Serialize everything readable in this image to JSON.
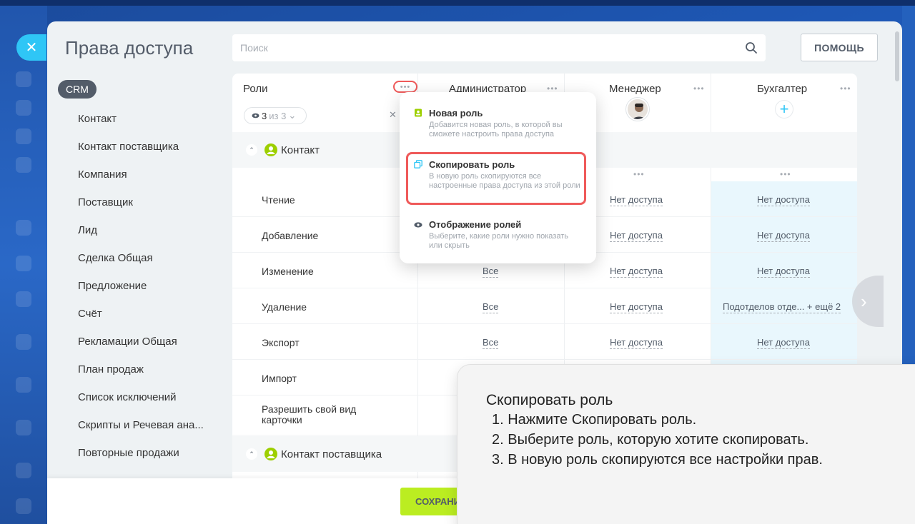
{
  "page": {
    "title": "Права доступа",
    "search_placeholder": "Поиск",
    "help_label": "ПОМОЩЬ",
    "close_symbol": "✕",
    "save_label": "СОХРАНИТЬ"
  },
  "sidebar": {
    "badge": "CRM",
    "items": [
      "Контакт",
      "Контакт поставщика",
      "Компания",
      "Поставщик",
      "Лид",
      "Сделка Общая",
      "Предложение",
      "Счёт",
      "Рекламации Общая",
      "План продаж",
      "Список исключений",
      "Скрипты и Речевая ана...",
      "Повторные продажи"
    ]
  },
  "table": {
    "roles_header": "Роли",
    "chip": {
      "count": "3",
      "of": "из 3"
    },
    "columns": [
      "Администратор",
      "Менеджер",
      "Бухгалтер"
    ],
    "section_contact": "Контакт",
    "section_supplier": "Контакт поставщика",
    "rows": [
      {
        "label": "Чтение",
        "admin": "",
        "manager": "Нет доступа",
        "accountant": "Нет доступа"
      },
      {
        "label": "Добавление",
        "admin": "",
        "manager": "Нет доступа",
        "accountant": "Нет доступа"
      },
      {
        "label": "Изменение",
        "admin": "Все",
        "manager": "Нет доступа",
        "accountant": "Нет доступа"
      },
      {
        "label": "Удаление",
        "admin": "Все",
        "manager": "Нет доступа",
        "accountant": "Подотделов отде... + ещё 2"
      },
      {
        "label": "Экспорт",
        "admin": "Все",
        "manager": "Нет доступа",
        "accountant": "Нет доступа"
      },
      {
        "label": "Импорт",
        "admin": "",
        "manager": "",
        "accountant": ""
      },
      {
        "label": "Разрешить свой вид карточки",
        "admin": "",
        "manager": "",
        "accountant": ""
      }
    ]
  },
  "menu": {
    "items": [
      {
        "title": "Новая роль",
        "desc": "Добавится новая роль, в которой вы сможете настроить права доступа"
      },
      {
        "title": "Скопировать роль",
        "desc": "В новую роль скопируются все настроенные права доступа из этой роли"
      },
      {
        "title": "Отображение ролей",
        "desc": "Выберите, какие роли нужно показать или скрыть"
      }
    ]
  },
  "tip": {
    "title": "Скопировать роль",
    "steps": [
      "1. Нажмите Скопировать роль.",
      "2. Выберите роль, которую хотите скопировать.",
      "3. В новую роль скопируются все настройки прав."
    ]
  },
  "colors": {
    "accent_blue": "#2fc6f6",
    "save_green": "#bbed21",
    "highlight_red": "#ef5a5a",
    "section_green": "#9dcf00"
  }
}
